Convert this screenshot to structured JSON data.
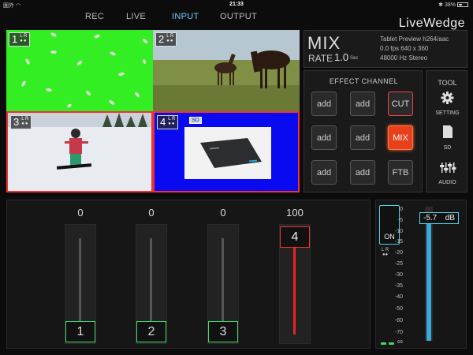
{
  "status": {
    "carrier": "圏外 ◠",
    "time": "21:33",
    "battery": "✱ 38%"
  },
  "nav": {
    "tabs": [
      "REC",
      "LIVE",
      "INPUT",
      "OUTPUT"
    ],
    "active": "INPUT"
  },
  "brand": "LiveWedge",
  "inputs": [
    {
      "num": "1",
      "l": "L",
      "r": "R",
      "dots": "●●"
    },
    {
      "num": "2",
      "l": "L",
      "r": "R",
      "dots": "●●"
    },
    {
      "num": "3",
      "l": "L",
      "r": "R",
      "dots": "●●"
    },
    {
      "num": "4",
      "l": "L",
      "r": "R",
      "dots": "●●",
      "tag": "SD"
    }
  ],
  "info": {
    "mode": "MIX",
    "rate_label": "RATE",
    "rate_value": "1.0",
    "rate_unit": "Sec",
    "preview": "Tablet Preview h264/aac",
    "fps_line": "0.0  fps  640 x 360",
    "audio_line": "48000 Hz  Stereo"
  },
  "effect": {
    "title": "EFFECT CHANNEL",
    "buttons": [
      "add",
      "add",
      "CUT",
      "add",
      "add",
      "MIX",
      "add",
      "add",
      "FTB"
    ]
  },
  "tool": {
    "title": "TOOL",
    "setting": "SETTING",
    "sd": "SD",
    "audio": "AUDIO",
    "icons": [
      "gear-icon",
      "sd-card-icon",
      "mixer-sliders-icon"
    ]
  },
  "faders": [
    {
      "label": "1",
      "value": "0",
      "level": 0
    },
    {
      "label": "2",
      "value": "0",
      "level": 0
    },
    {
      "label": "3",
      "value": "0",
      "level": 0
    },
    {
      "label": "4",
      "value": "100",
      "level": 100
    }
  ],
  "audio": {
    "on_label": "ON",
    "lr_l": "L",
    "lr_r": "R",
    "lr_dots": "●●",
    "db_value": "-5.7",
    "db_unit": "dB",
    "scale": [
      "0",
      "-5",
      "-10",
      "-15",
      "-20",
      "-25",
      "-30",
      "-35",
      "-40",
      "-50",
      "-60",
      "-70",
      "∞"
    ]
  },
  "colors": {
    "accent": "#2f93d6",
    "green_input": "#33ee22",
    "blue_input": "#0a0af0",
    "mix_active": "#e8401a",
    "selected_border": "#e33333",
    "fader_on": "#3fd86a",
    "audio_on": "#4bd5e8"
  }
}
